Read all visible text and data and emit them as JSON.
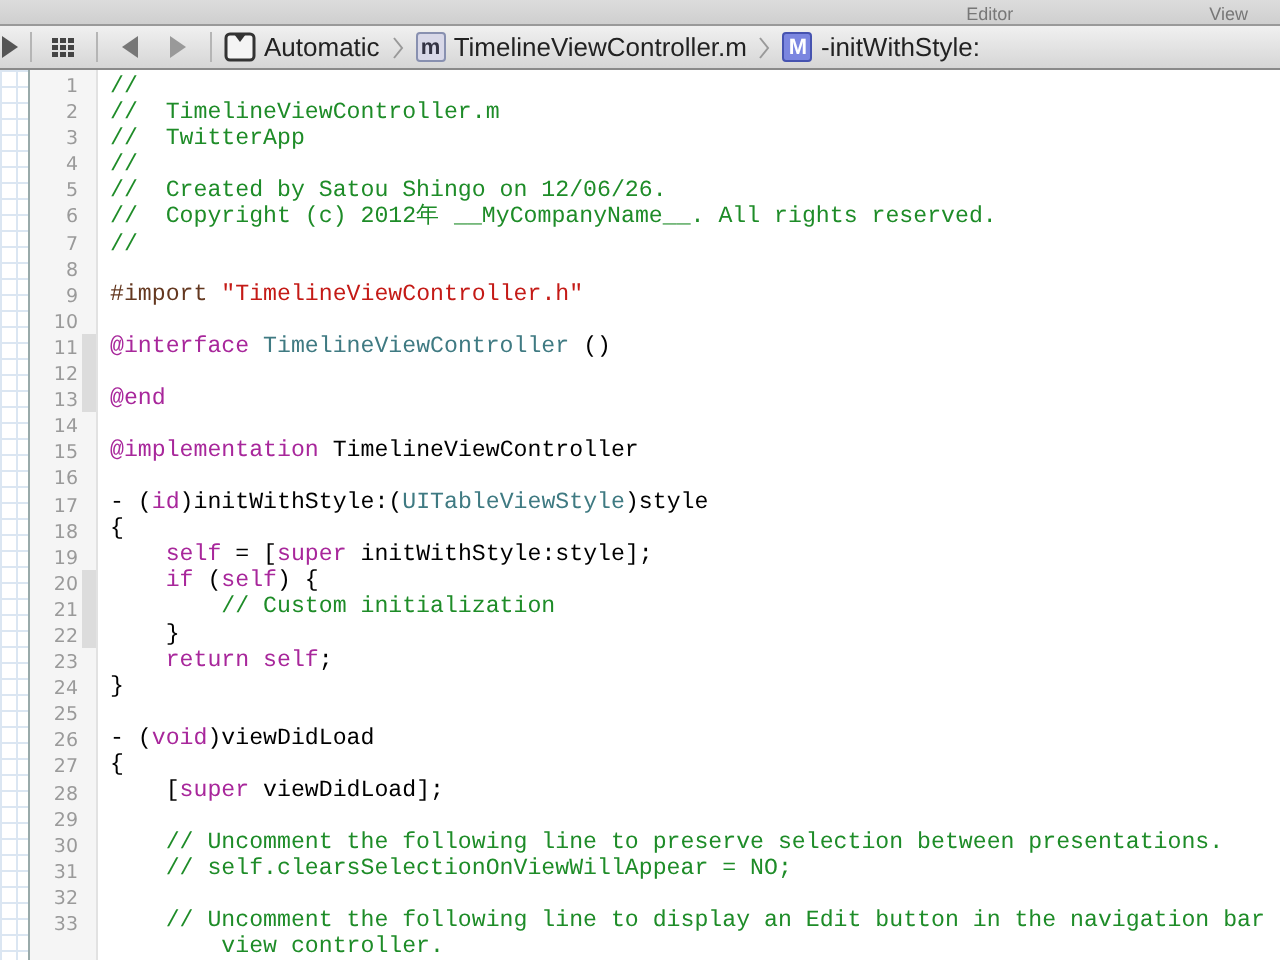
{
  "toolbar": {
    "labels": [
      "Editor",
      "View"
    ]
  },
  "jump_bar": {
    "items": [
      {
        "kind": "scheme",
        "text": "Automatic"
      },
      {
        "kind": "file",
        "badge": "m",
        "text": "TimelineViewController.m"
      },
      {
        "kind": "method",
        "badge": "M",
        "text": "-initWithStyle:"
      }
    ]
  },
  "editor": {
    "lines": [
      {
        "number": "1",
        "marked": false,
        "tokens": [
          {
            "kind": "comment",
            "text": "//"
          }
        ]
      },
      {
        "number": "2",
        "marked": false,
        "tokens": [
          {
            "kind": "comment",
            "text": "//  TimelineViewController.m"
          }
        ]
      },
      {
        "number": "3",
        "marked": false,
        "tokens": [
          {
            "kind": "comment",
            "text": "//  TwitterApp"
          }
        ]
      },
      {
        "number": "4",
        "marked": false,
        "tokens": [
          {
            "kind": "comment",
            "text": "//"
          }
        ]
      },
      {
        "number": "5",
        "marked": false,
        "tokens": [
          {
            "kind": "comment",
            "text": "//  Created by Satou Shingo on 12/06/26."
          }
        ]
      },
      {
        "number": "6",
        "marked": false,
        "tokens": [
          {
            "kind": "comment",
            "text": "//  Copyright (c) 2012年 __MyCompanyName__. All rights reserved."
          }
        ]
      },
      {
        "number": "7",
        "marked": false,
        "tokens": [
          {
            "kind": "comment",
            "text": "//"
          }
        ]
      },
      {
        "number": "8",
        "marked": false
      },
      {
        "number": "9",
        "marked": false,
        "tokens": [
          {
            "kind": "preprocessor",
            "text": "#import "
          },
          {
            "kind": "string",
            "text": "\"TimelineViewController.h\""
          }
        ]
      },
      {
        "number": "10",
        "marked": false
      },
      {
        "number": "11",
        "marked": true,
        "tokens": [
          {
            "kind": "keyword",
            "text": "@interface"
          },
          {
            "kind": "type",
            "text": " TimelineViewController"
          },
          {
            "kind": "plain",
            "text": " ()"
          }
        ]
      },
      {
        "number": "12",
        "marked": true
      },
      {
        "number": "13",
        "marked": true,
        "tokens": [
          {
            "kind": "keyword",
            "text": "@end"
          }
        ]
      },
      {
        "number": "14",
        "marked": false
      },
      {
        "number": "15",
        "marked": false,
        "tokens": [
          {
            "kind": "keyword",
            "text": "@implementation"
          },
          {
            "kind": "plain",
            "text": " TimelineViewController"
          }
        ]
      },
      {
        "number": "16",
        "marked": false
      },
      {
        "number": "17",
        "marked": false,
        "tokens": [
          {
            "kind": "plain",
            "text": "- ("
          },
          {
            "kind": "keyword",
            "text": "id"
          },
          {
            "kind": "plain",
            "text": ")initWithStyle:("
          },
          {
            "kind": "type",
            "text": "UITableViewStyle"
          },
          {
            "kind": "plain",
            "text": ")style"
          }
        ]
      },
      {
        "number": "18",
        "marked": false,
        "tokens": [
          {
            "kind": "plain",
            "text": "{"
          }
        ]
      },
      {
        "number": "19",
        "marked": false,
        "tokens": [
          {
            "kind": "keyword",
            "text": "    self"
          },
          {
            "kind": "plain",
            "text": " = ["
          },
          {
            "kind": "keyword",
            "text": "super"
          },
          {
            "kind": "plain",
            "text": " initWithStyle:style];"
          }
        ]
      },
      {
        "number": "20",
        "marked": true,
        "tokens": [
          {
            "kind": "keyword",
            "text": "    if"
          },
          {
            "kind": "plain",
            "text": " ("
          },
          {
            "kind": "keyword",
            "text": "self"
          },
          {
            "kind": "plain",
            "text": ") {"
          }
        ]
      },
      {
        "number": "21",
        "marked": true,
        "tokens": [
          {
            "kind": "comment",
            "text": "        // Custom initialization"
          }
        ]
      },
      {
        "number": "22",
        "marked": true,
        "tokens": [
          {
            "kind": "plain",
            "text": "    }"
          }
        ]
      },
      {
        "number": "23",
        "marked": false,
        "tokens": [
          {
            "kind": "keyword",
            "text": "    return self"
          },
          {
            "kind": "plain",
            "text": ";"
          }
        ]
      },
      {
        "number": "24",
        "marked": false,
        "tokens": [
          {
            "kind": "plain",
            "text": "}"
          }
        ]
      },
      {
        "number": "25",
        "marked": false
      },
      {
        "number": "26",
        "marked": false,
        "tokens": [
          {
            "kind": "plain",
            "text": "- ("
          },
          {
            "kind": "keyword",
            "text": "void"
          },
          {
            "kind": "plain",
            "text": ")viewDidLoad"
          }
        ]
      },
      {
        "number": "27",
        "marked": false,
        "tokens": [
          {
            "kind": "plain",
            "text": "{"
          }
        ]
      },
      {
        "number": "28",
        "marked": false,
        "tokens": [
          {
            "kind": "plain",
            "text": "    ["
          },
          {
            "kind": "keyword",
            "text": "super"
          },
          {
            "kind": "plain",
            "text": " viewDidLoad];"
          }
        ]
      },
      {
        "number": "29",
        "marked": false
      },
      {
        "number": "30",
        "marked": false,
        "tokens": [
          {
            "kind": "comment",
            "text": "    // Uncomment the following line to preserve selection between presentations."
          }
        ]
      },
      {
        "number": "31",
        "marked": false,
        "tokens": [
          {
            "kind": "comment",
            "text": "    // self.clearsSelectionOnViewWillAppear = NO;"
          }
        ]
      },
      {
        "number": "32",
        "marked": false
      },
      {
        "number": "33",
        "marked": false,
        "tokens": [
          {
            "kind": "comment",
            "text": "    // Uncomment the following line to display an Edit button in the navigation bar"
          }
        ]
      },
      {
        "marked": false,
        "tokens": [
          {
            "kind": "comment",
            "text": "        view controller."
          }
        ]
      }
    ]
  }
}
